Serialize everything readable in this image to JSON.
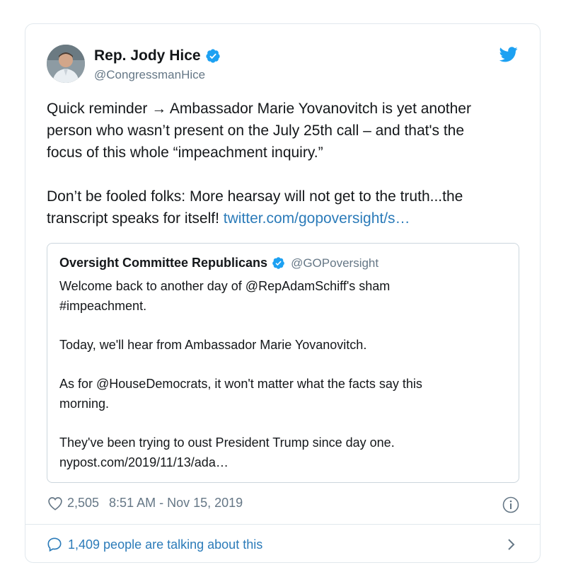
{
  "author": {
    "name": "Rep. Jody Hice",
    "handle": "@CongressmanHice"
  },
  "tweet": {
    "line1": "Quick reminder → Ambassador Marie Yovanovitch is yet another",
    "line2": "person who wasn’t present on the July 25th call – and that's the",
    "line3": "focus of this whole “impeachment inquiry.”",
    "line4": "Don’t be fooled folks: More hearsay will not get to the truth...the",
    "line5_text": "transcript speaks for itself! ",
    "line5_link": "twitter.com/gopoversight/s…"
  },
  "quoted": {
    "name": "Oversight Committee Republicans",
    "handle": "@GOPoversight",
    "line1": "Welcome back to another day of @RepAdamSchiff's sham",
    "line2": "#impeachment.",
    "line3": "Today, we'll hear from Ambassador Marie Yovanovitch.",
    "line4": "As for @HouseDemocrats, it won't matter what the facts say this",
    "line5": "morning.",
    "line6": "They've been trying to oust President Trump since day one.",
    "line7": "nypost.com/2019/11/13/ada…"
  },
  "meta": {
    "likes": "2,505",
    "timestamp": "8:51 AM - Nov 15, 2019"
  },
  "footer": {
    "talking": "1,409 people are talking about this"
  },
  "colors": {
    "link": "#2b7bb9",
    "verified": "#1da1f2",
    "muted": "#657786"
  },
  "icons": [
    "verified-badge-icon",
    "twitter-bird-icon",
    "heart-icon",
    "info-icon",
    "comment-bubble-icon",
    "chevron-right-icon"
  ]
}
